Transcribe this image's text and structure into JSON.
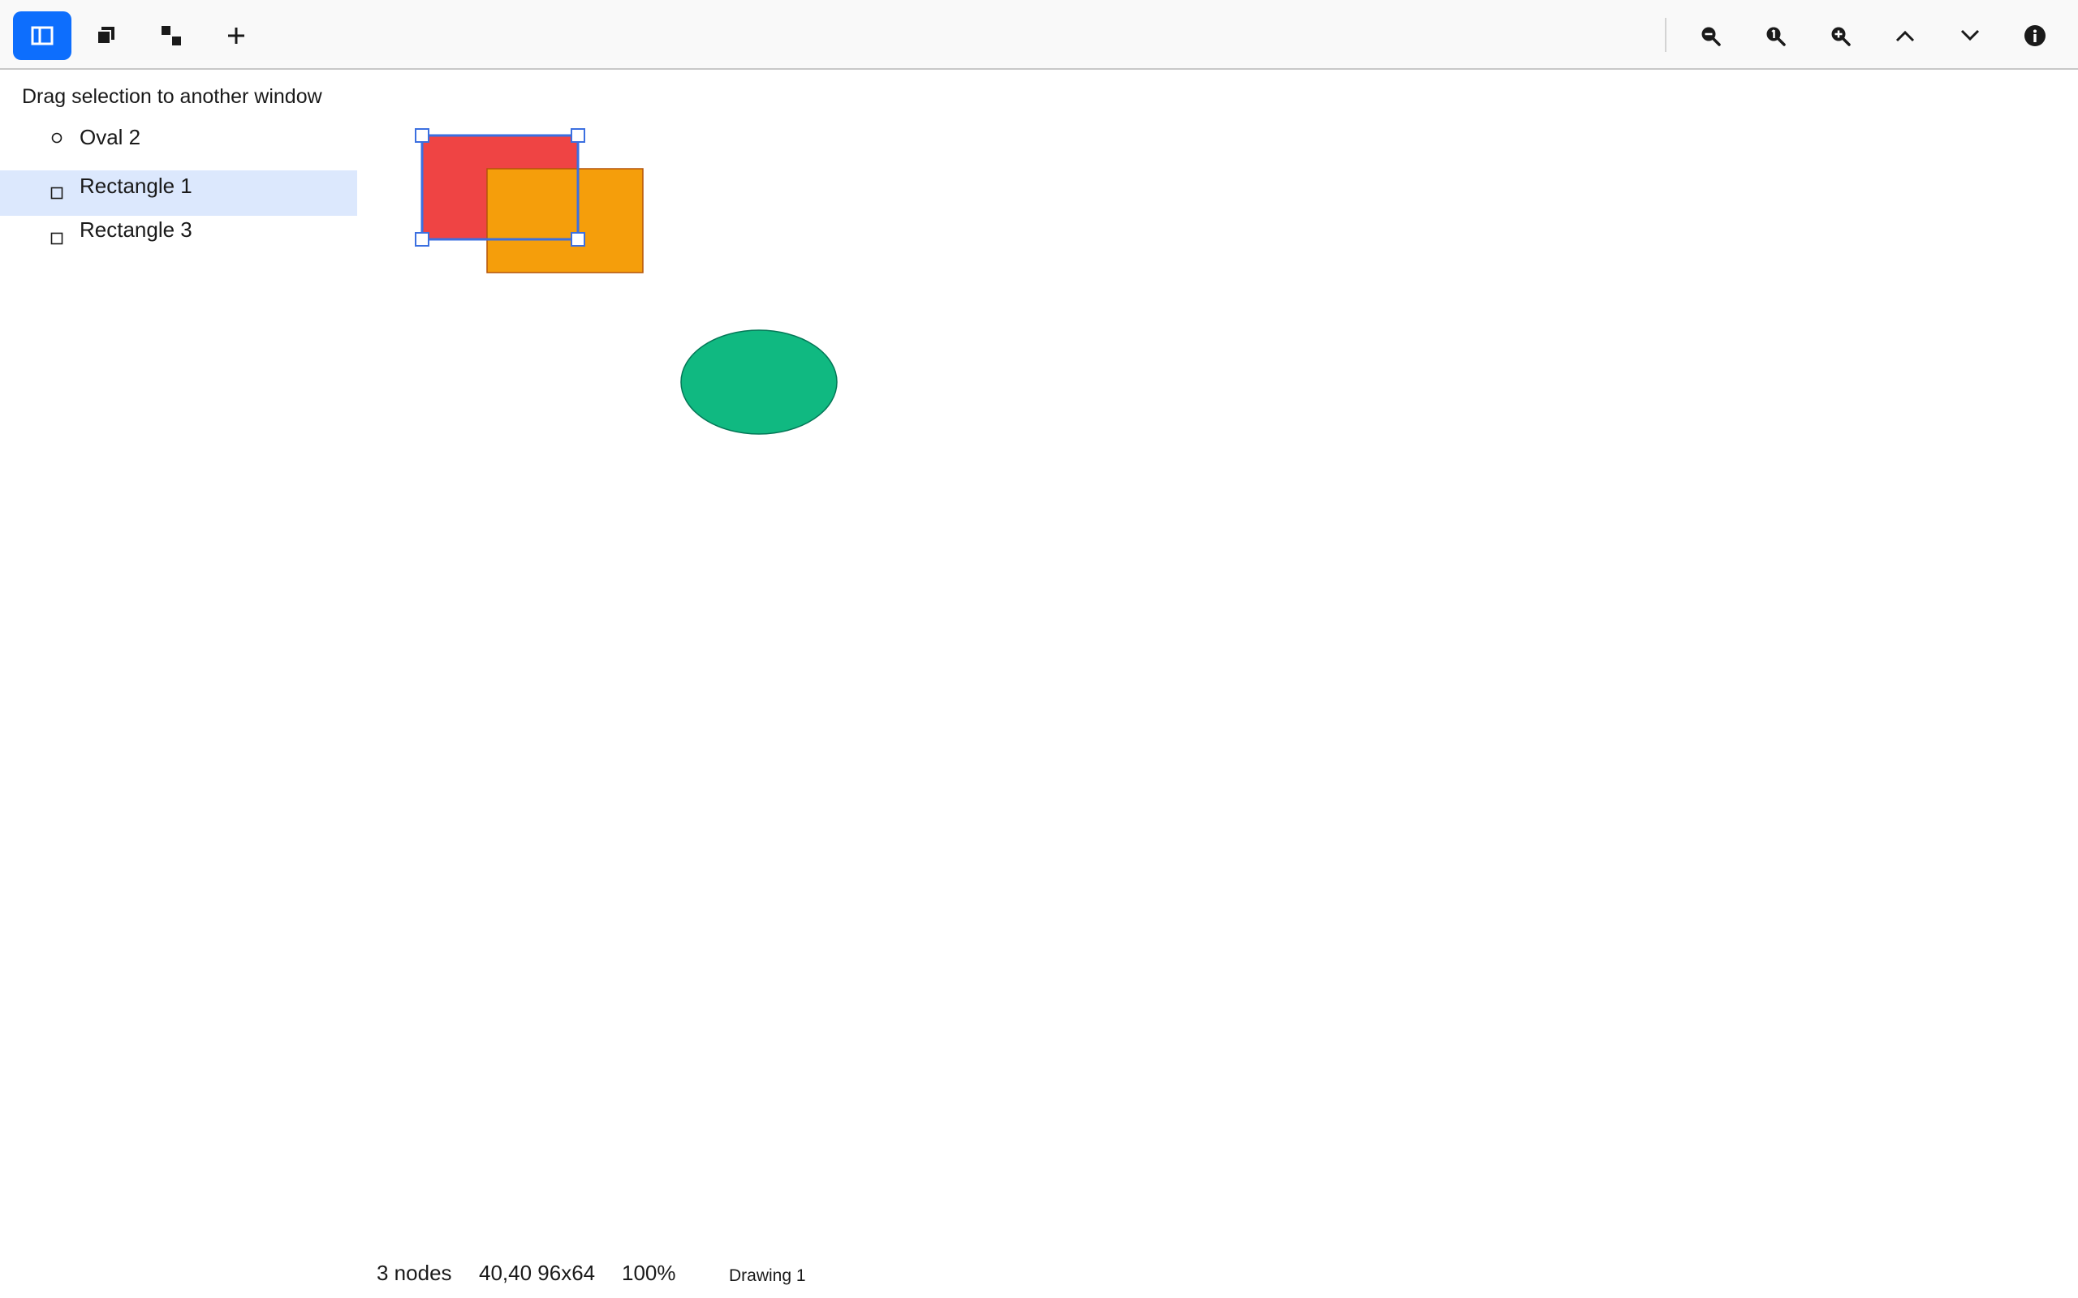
{
  "toolbar": {
    "left_buttons": [
      {
        "name": "toggle-sidebar-button",
        "icon": "sidebar-panel-icon",
        "active": true
      },
      {
        "name": "group-button",
        "icon": "stacked-squares-icon",
        "active": false
      },
      {
        "name": "arrange-button",
        "icon": "diagonal-squares-icon",
        "active": false
      },
      {
        "name": "add-button",
        "icon": "plus-icon",
        "active": false
      }
    ],
    "right_buttons": [
      {
        "name": "zoom-out-button",
        "icon": "zoom-out-icon"
      },
      {
        "name": "zoom-reset-button",
        "icon": "zoom-actual-size-icon"
      },
      {
        "name": "zoom-in-button",
        "icon": "zoom-in-icon"
      },
      {
        "name": "move-up-button",
        "icon": "chevron-up-icon"
      },
      {
        "name": "move-down-button",
        "icon": "chevron-down-icon"
      },
      {
        "name": "info-button",
        "icon": "info-icon"
      }
    ],
    "accent_color": "#0d6efd"
  },
  "sidebar": {
    "hint": "Drag selection to another window",
    "items": [
      {
        "label": "Oval 2",
        "icon": "○",
        "icon_name": "oval-icon",
        "selected": false
      },
      {
        "label": "Rectangle 1",
        "icon": "□",
        "icon_name": "rectangle-icon",
        "selected": true
      },
      {
        "label": "Rectangle 3",
        "icon": "□",
        "icon_name": "rectangle-icon",
        "selected": false
      }
    ],
    "selection_color": "#dce8fd"
  },
  "canvas": {
    "shapes": [
      {
        "name": "Rectangle 1",
        "kind": "rect",
        "fill": "#ef4444",
        "selected": true
      },
      {
        "name": "Rectangle 3",
        "kind": "rect",
        "fill": "#f59e0b",
        "selected": false
      },
      {
        "name": "Oval 2",
        "kind": "ellipse",
        "fill": "#10b981",
        "selected": false
      }
    ],
    "selection_color": "#3b6fe0"
  },
  "status": {
    "node_count": "3 nodes",
    "selection_geometry": "40,40 96x64",
    "zoom": "100%",
    "document_name": "Drawing 1"
  }
}
